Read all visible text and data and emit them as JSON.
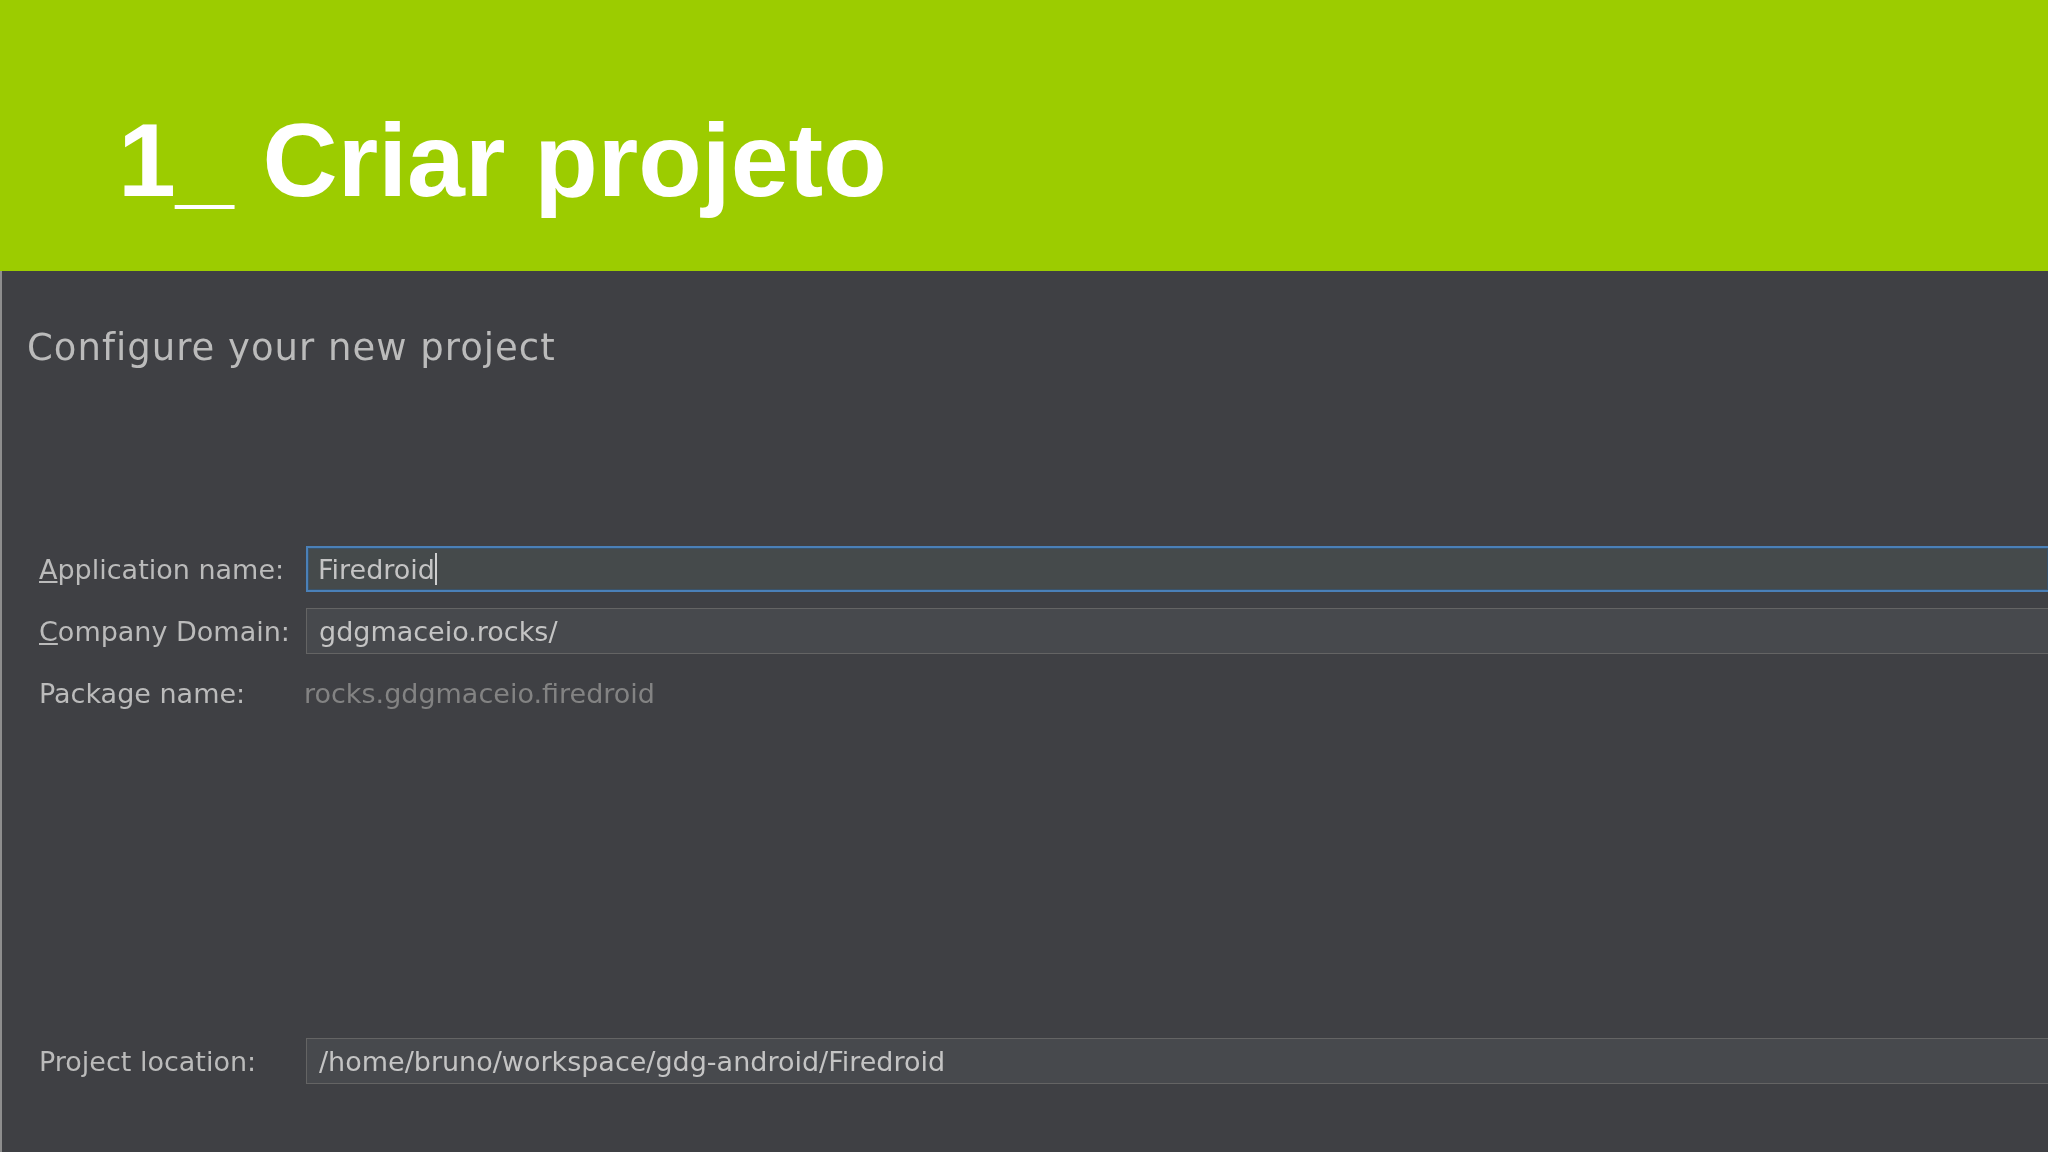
{
  "slide": {
    "title": "1_ Criar projeto"
  },
  "dialog": {
    "heading": "Configure your new project",
    "fields": [
      {
        "kind": "input",
        "label": "Application name:",
        "mnemonic": true,
        "value": "Firedroid",
        "focused": true
      },
      {
        "kind": "input",
        "label": "Company Domain:",
        "mnemonic": true,
        "value": "gdgmaceio.rocks/",
        "focused": false
      },
      {
        "kind": "readonly",
        "label": "Package name:",
        "mnemonic": false,
        "value": "rocks.gdgmaceio.firedroid"
      }
    ],
    "location": {
      "kind": "input",
      "label": "Project location:",
      "mnemonic": false,
      "value": "/home/bruno/workspace/gdg-android/Firedroid",
      "focused": false
    }
  }
}
